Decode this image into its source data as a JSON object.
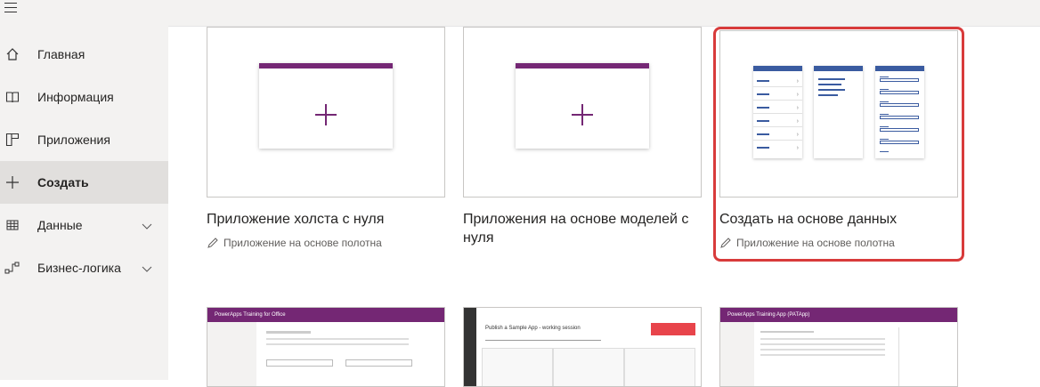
{
  "sidebar": {
    "items": [
      {
        "label": "Главная",
        "icon": "home-icon"
      },
      {
        "label": "Информация",
        "icon": "book-icon"
      },
      {
        "label": "Приложения",
        "icon": "apps-icon"
      },
      {
        "label": "Создать",
        "icon": "plus-icon",
        "active": true
      },
      {
        "label": "Данные",
        "icon": "table-icon",
        "expandable": true
      },
      {
        "label": "Бизнес-логика",
        "icon": "flow-icon",
        "expandable": true
      }
    ]
  },
  "cards": [
    {
      "title": "Приложение холста с нуля",
      "subtitle": "Приложение на основе полотна"
    },
    {
      "title": "Приложения на основе моделей с нуля",
      "subtitle": ""
    },
    {
      "title": "Создать на основе данных",
      "subtitle": "Приложение на основе полотна",
      "highlighted": true
    }
  ],
  "samples": [
    {
      "header": "PowerApps Training for Office"
    },
    {
      "header": "Publish a Sample App - working session"
    },
    {
      "header": "PowerApps Training App (PATApp)"
    }
  ],
  "colors": {
    "accent": "#742774",
    "highlight": "#d83b3b",
    "data_blue": "#3a5ba0",
    "sidebar": "#f3f2f1"
  }
}
